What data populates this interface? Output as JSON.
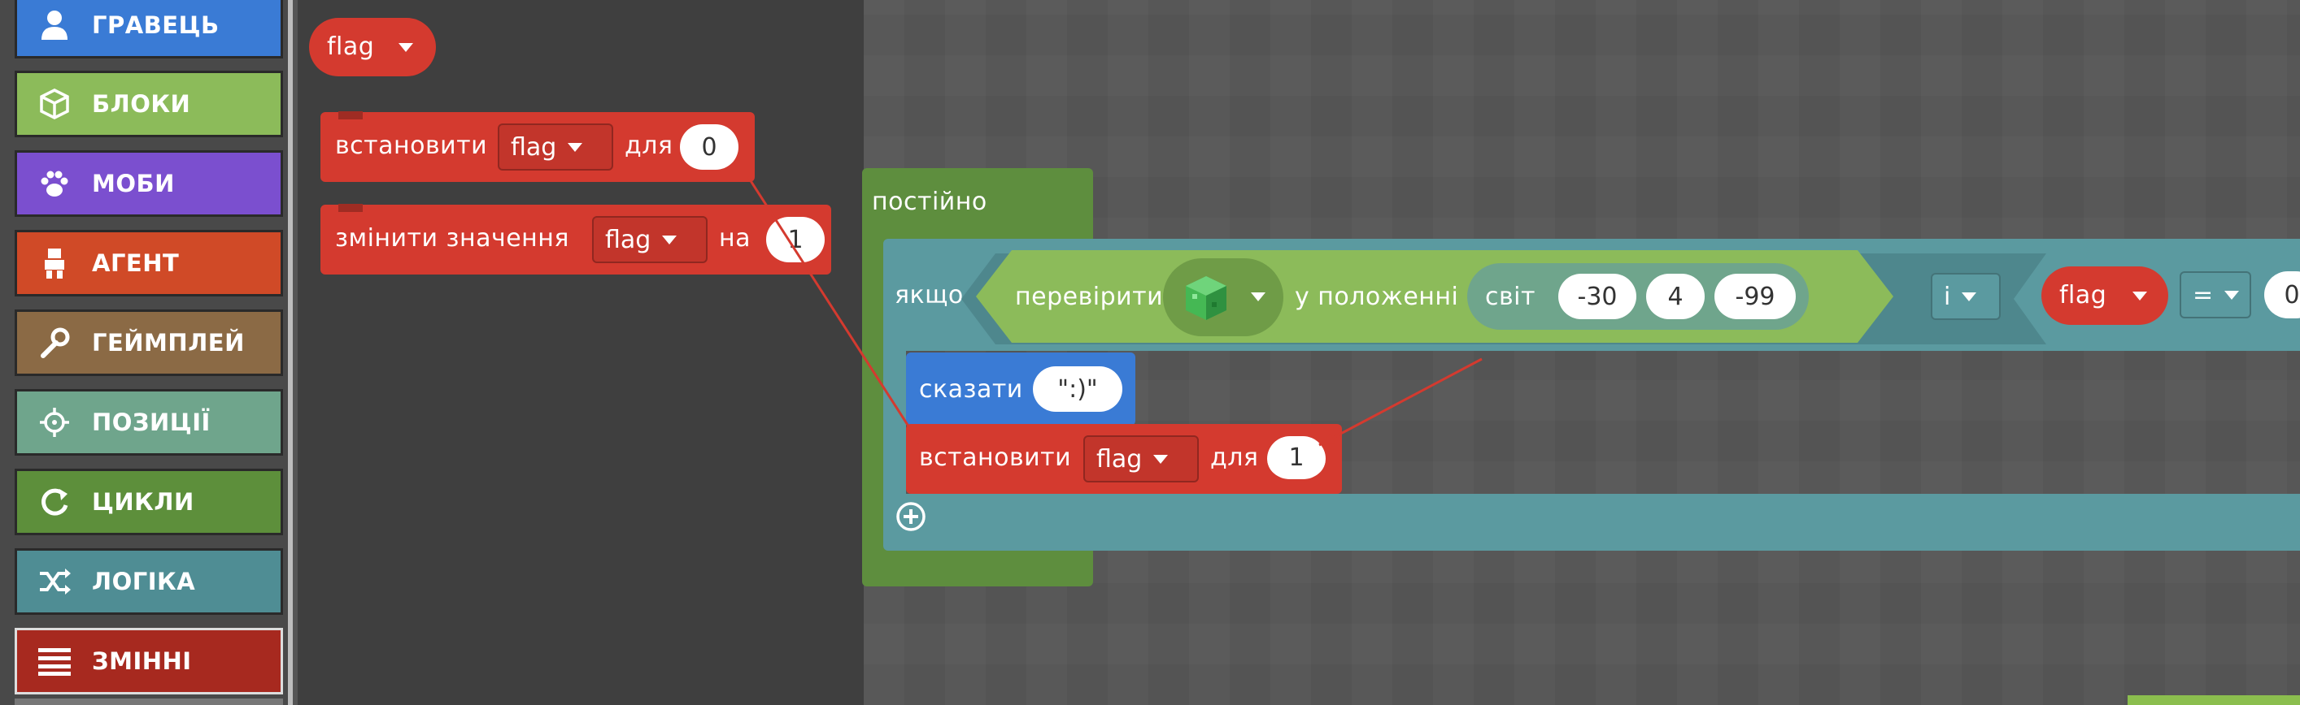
{
  "toolbox": {
    "categories": [
      {
        "label": "ГРАВЕЦЬ",
        "color": "#3a7bd5"
      },
      {
        "label": "БЛОКИ",
        "color": "#8cbb5a"
      },
      {
        "label": "МОБИ",
        "color": "#7b4fcf"
      },
      {
        "label": "АГЕНТ",
        "color": "#d04a27"
      },
      {
        "label": "ГЕЙМПЛЕЙ",
        "color": "#8b6a45"
      },
      {
        "label": "ПОЗИЦІЇ",
        "color": "#6fa58c"
      },
      {
        "label": "ЦИКЛИ",
        "color": "#5d8f3b"
      },
      {
        "label": "ЛОГІКА",
        "color": "#4f8d94"
      },
      {
        "label": "ЗМІННІ",
        "color": "#a7291f"
      }
    ]
  },
  "flyout": {
    "var_block": {
      "label": "flag"
    },
    "set_block": {
      "verb": "встановити",
      "var": "flag",
      "prep": "для",
      "value": "0"
    },
    "change_block": {
      "verb": "змінити значення",
      "var": "flag",
      "prep": "на",
      "value": "1"
    }
  },
  "workspace": {
    "forever": {
      "label": "постійно"
    },
    "if_block": {
      "label": "якщо",
      "check": "перевірити",
      "at_position": "у положенні",
      "world": "світ",
      "x": "-30",
      "y": "4",
      "z": "-99",
      "logic_op": "і",
      "var": "flag",
      "compare_op": "=",
      "compare_value": "0"
    },
    "say_block": {
      "verb": "сказати",
      "value": "\":)\""
    },
    "set_block": {
      "verb": "встановити",
      "var": "flag",
      "prep": "для",
      "value": "1"
    }
  },
  "colors": {
    "variables": "#d43a2f",
    "loops": "#5e8e3e",
    "logic": "#5b9aa0",
    "blocks": "#8cbb5a",
    "player": "#3a7bd5"
  }
}
